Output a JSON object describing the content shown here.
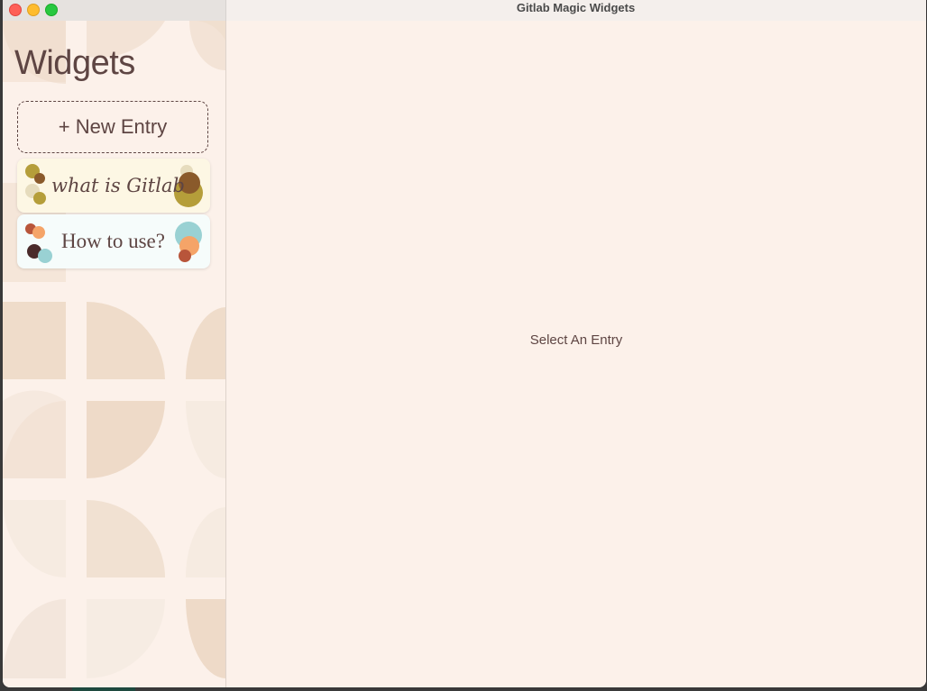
{
  "window": {
    "title": "Gitlab Magic Widgets"
  },
  "sidebar": {
    "title": "Widgets",
    "new_entry_label": "+ New Entry",
    "entries": [
      {
        "label": "what is Gitlab",
        "colors": [
          "#b59e3a",
          "#8a5a2b",
          "#e6dcbd"
        ]
      },
      {
        "label": "How to use?",
        "colors": [
          "#b8553a",
          "#f5a468",
          "#4a2a2a",
          "#99d1d3"
        ]
      }
    ]
  },
  "main": {
    "placeholder": "Select An Entry"
  },
  "colors": {
    "background": "#fcf1ea",
    "text": "#5e4543",
    "pattern_dark": "#efdcca",
    "pattern_light": "#f6e9df"
  }
}
